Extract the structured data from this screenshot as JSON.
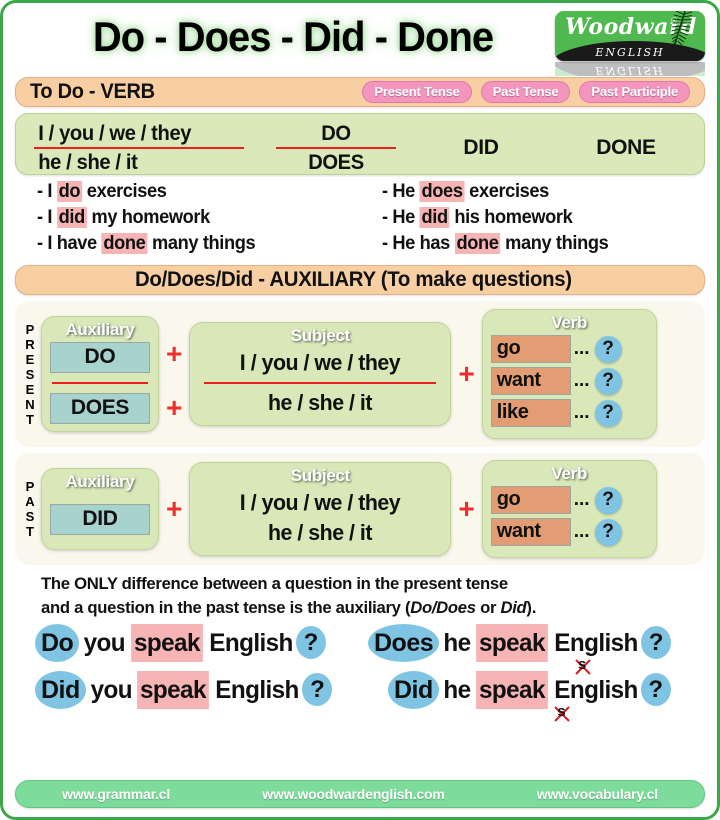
{
  "colors": {
    "border_green": "#3da64a",
    "banner_orange": "#f8cfa2",
    "pill_pink": "#f395bc",
    "card_green": "#d8e8b8",
    "aux_teal": "#a8d2cd",
    "verb_salmon": "#e39d74",
    "bubble_blue": "#7fc5e3",
    "highlight_pink": "#f7b4b4",
    "accent_red": "#ef1f1f",
    "footer_green": "#7ddc9c"
  },
  "header": {
    "title": "Do - Does - Did - Done",
    "logo": {
      "word": "Woodward",
      "sub": "ENGLISH",
      "registered": "®"
    }
  },
  "verb_banner": {
    "title": "To Do - VERB",
    "pills": [
      "Present Tense",
      "Past Tense",
      "Past Participle"
    ]
  },
  "conjugation": {
    "subject_line1": "I / you / we / they",
    "subject_line2": "he / she / it",
    "present_line1": "DO",
    "present_line2": "DOES",
    "past": "DID",
    "participle": "DONE"
  },
  "examples": {
    "left": [
      {
        "pre": "- I ",
        "hl": "do",
        "post": " exercises"
      },
      {
        "pre": "- I ",
        "hl": "did",
        "post": " my homework"
      },
      {
        "pre": "- I have ",
        "hl": "done",
        "post": " many things"
      }
    ],
    "right": [
      {
        "pre": "- He ",
        "hl": "does",
        "post": " exercises"
      },
      {
        "pre": "- He ",
        "hl": "did",
        "post": " his homework"
      },
      {
        "pre": "- He has ",
        "hl": "done",
        "post": " many things"
      }
    ]
  },
  "aux_banner": {
    "title": "Do/Does/Did - AUXILIARY  (To make questions)"
  },
  "present_block": {
    "tense_label": "PRESENT",
    "auxiliary": {
      "title": "Auxiliary",
      "items": [
        "DO",
        "DOES"
      ]
    },
    "subject": {
      "title": "Subject",
      "line1": "I / you / we / they",
      "line2": "he / she / it"
    },
    "verb": {
      "title": "Verb",
      "items": [
        "go",
        "want",
        "like"
      ],
      "dots": "...",
      "qmark": "?"
    },
    "plus": "+"
  },
  "past_block": {
    "tense_label": "PAST",
    "auxiliary": {
      "title": "Auxiliary",
      "items": [
        "DID"
      ]
    },
    "subject": {
      "title": "Subject",
      "line1": "I / you / we / they",
      "line2": "he / she / it"
    },
    "verb": {
      "title": "Verb",
      "items": [
        "go",
        "want"
      ],
      "dots": "...",
      "qmark": "?"
    },
    "plus": "+"
  },
  "explanation": {
    "line1": "The ONLY difference between a question in the present tense",
    "line2_a": "and a question in the past tense is the auxiliary (",
    "line2_italic1": "Do/Does",
    "line2_b": " or ",
    "line2_italic2": "Did",
    "line2_c": ")."
  },
  "questions": [
    {
      "aux": "Do",
      "subject": "you",
      "verb": "speak",
      "object": "English",
      "qmark": "?",
      "struck_s": false
    },
    {
      "aux": "Does",
      "subject": "he",
      "verb": "speak",
      "object": "English",
      "qmark": "?",
      "struck_s": true,
      "struck_letter": "s"
    },
    {
      "aux": "Did",
      "subject": "you",
      "verb": "speak",
      "object": "English",
      "qmark": "?",
      "struck_s": false
    },
    {
      "aux": "Did",
      "subject": "he",
      "verb": "speak",
      "object": "English",
      "qmark": "?",
      "struck_s": true,
      "struck_letter": "s"
    }
  ],
  "footer": {
    "links": [
      "www.grammar.cl",
      "www.woodwardenglish.com",
      "www.vocabulary.cl"
    ]
  }
}
